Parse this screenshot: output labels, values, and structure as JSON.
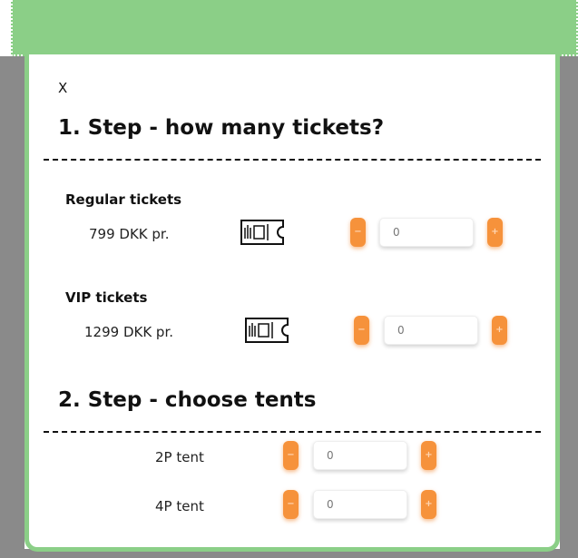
{
  "close_label": "X",
  "step1": {
    "title": "1. Step - how many tickets?",
    "tickets": [
      {
        "name": "Regular tickets",
        "price": "799 DKK pr.",
        "quantity": "0",
        "minus": "−",
        "plus": "+"
      },
      {
        "name": "VIP tickets",
        "price": "1299 DKK pr.",
        "quantity": "0",
        "minus": "−",
        "plus": "+"
      }
    ]
  },
  "step2": {
    "title": "2. Step - choose tents",
    "tents": [
      {
        "name": "2P tent",
        "quantity": "0",
        "minus": "−",
        "plus": "+"
      },
      {
        "name": "4P tent",
        "quantity": "0",
        "minus": "−",
        "plus": "+"
      }
    ]
  },
  "colors": {
    "header_green": "#8bcf87",
    "button_orange": "#f6923b"
  }
}
